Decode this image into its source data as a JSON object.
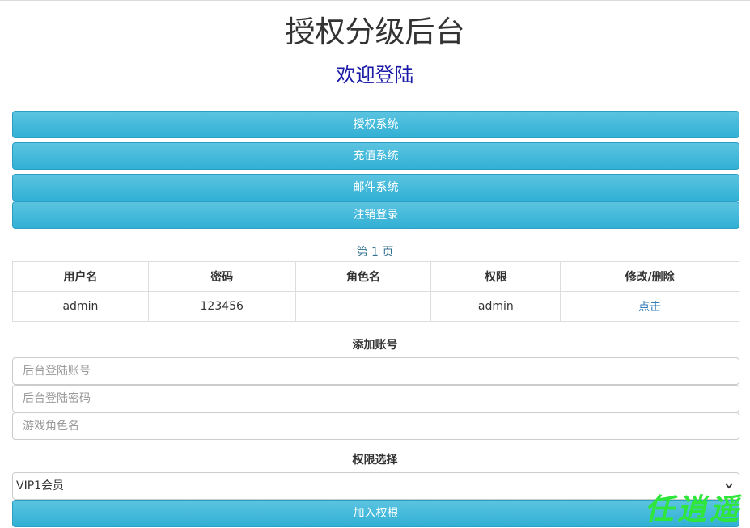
{
  "header": {
    "title": "授权分级后台",
    "subtitle": "欢迎登陆"
  },
  "nav_buttons": {
    "auth": "授权系统",
    "recharge": "充值系统",
    "mail": "邮件系统",
    "logout": "注销登录"
  },
  "pagination": {
    "label": "第 1 页"
  },
  "table": {
    "headers": [
      "用户名",
      "密码",
      "角色名",
      "权限",
      "修改/删除"
    ],
    "rows": [
      {
        "username": "admin",
        "password": "123456",
        "role": "",
        "permission": "admin",
        "action": "点击"
      }
    ]
  },
  "add_account": {
    "label": "添加账号",
    "account_placeholder": "后台登陆账号",
    "password_placeholder": "后台登陆密码",
    "role_placeholder": "游戏角色名"
  },
  "permission_select": {
    "label": "权限选择",
    "selected": "VIP1会员"
  },
  "submit": {
    "label": "加入权根"
  },
  "watermark": {
    "text": "任逍遥"
  },
  "colors": {
    "button": "#31b0d5",
    "subtitle": "#1a1aa6",
    "link": "#337ab7",
    "watermark": "#2fe63a"
  }
}
